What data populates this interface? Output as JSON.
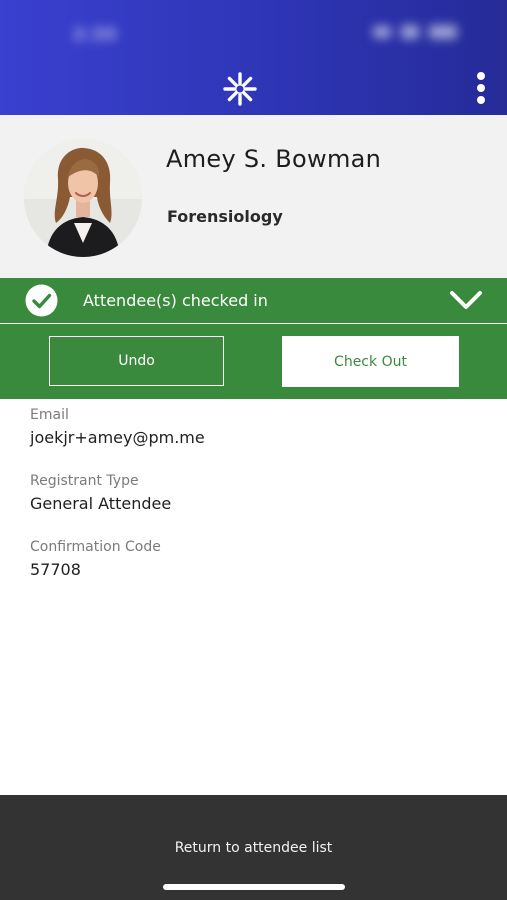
{
  "status_bar": {
    "time": "2:30"
  },
  "icons": {
    "logo": "asterisk-logo-icon",
    "menu": "more-vertical-icon",
    "check": "check-circle-icon",
    "expand": "chevron-down-icon"
  },
  "colors": {
    "header": "#3a40cf",
    "success": "#3a8a3e",
    "footer": "#333333"
  },
  "attendee": {
    "name": "Amey S. Bowman",
    "organization": "Forensiology"
  },
  "checkin": {
    "status": "Attendee(s) checked in",
    "undo_label": "Undo",
    "checkout_label": "Check Out"
  },
  "details": {
    "email_label": "Email",
    "email": "joekjr+amey@pm.me",
    "type_label": "Registrant Type",
    "type": "General Attendee",
    "code_label": "Confirmation Code",
    "code": "57708"
  },
  "footer": {
    "return_label": "Return to attendee list"
  }
}
